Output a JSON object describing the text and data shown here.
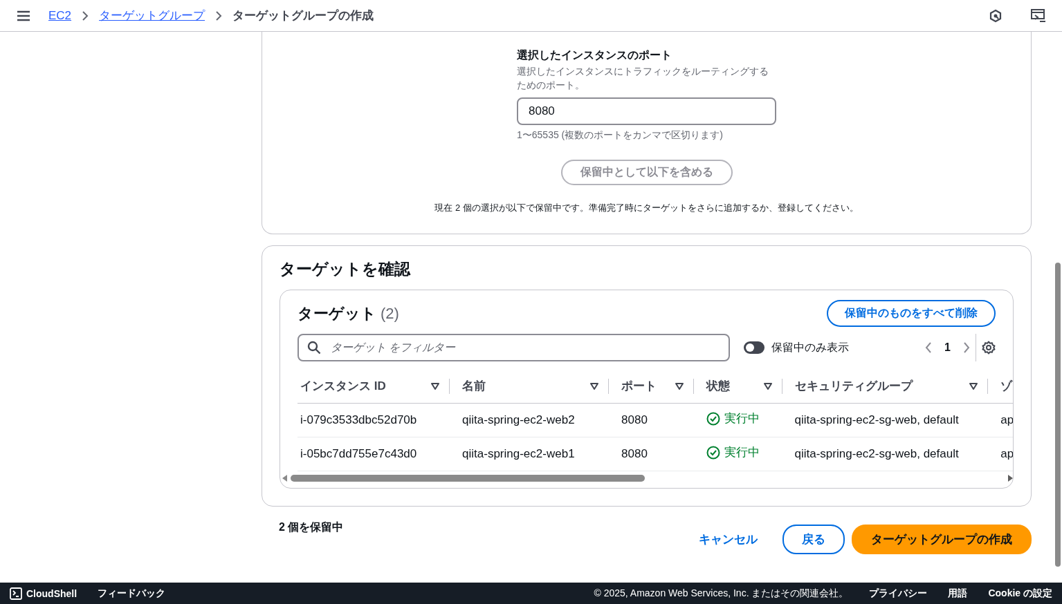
{
  "breadcrumbs": [
    {
      "label": "EC2",
      "link": true
    },
    {
      "label": "ターゲットグループ",
      "link": true
    },
    {
      "label": "ターゲットグループの作成",
      "link": false
    }
  ],
  "port_section": {
    "label": "選択したインスタンスのポート",
    "description": "選択したインスタンスにトラフィックをルーティングするためのポート。",
    "value": "8080",
    "hint": "1〜65535 (複数のポートをカンマで区切ります)",
    "include_button": "保留中として以下を含める",
    "pending_note": "現在 2 個の選択が以下で保留中です。準備完了時にターゲットをさらに追加するか、登録してください。"
  },
  "review": {
    "title": "ターゲットを確認",
    "targets": {
      "title": "ターゲット",
      "count": "(2)",
      "remove_all_button": "保留中のものをすべて削除",
      "filter_placeholder": "ターゲット をフィルター",
      "pending_only": {
        "label": "保留中のみ表示",
        "on": false
      },
      "page": "1",
      "columns": [
        "インスタンス ID",
        "名前",
        "ポート",
        "状態",
        "セキュリティグループ",
        "ゾ"
      ],
      "rows": [
        {
          "instance_id": "i-079c3533dbc52d70b",
          "name": "qiita-spring-ec2-web2",
          "port": "8080",
          "status": "実行中",
          "security_groups": "qiita-spring-ec2-sg-web, default",
          "column_6": "ap"
        },
        {
          "instance_id": "i-05bc7dd755e7c43d0",
          "name": "qiita-spring-ec2-web1",
          "port": "8080",
          "status": "実行中",
          "security_groups": "qiita-spring-ec2-sg-web, default",
          "column_6": "ap"
        }
      ]
    }
  },
  "footer": {
    "pending_count": "2 個を保留中",
    "cancel": "キャンセル",
    "back": "戻る",
    "create": "ターゲットグループの作成"
  },
  "bottom_bar": {
    "cloudshell": "CloudShell",
    "feedback": "フィードバック",
    "copyright": "© 2025, Amazon Web Services, Inc. またはその関連会社。",
    "links": [
      "プライバシー",
      "用語",
      "Cookie の設定"
    ]
  }
}
